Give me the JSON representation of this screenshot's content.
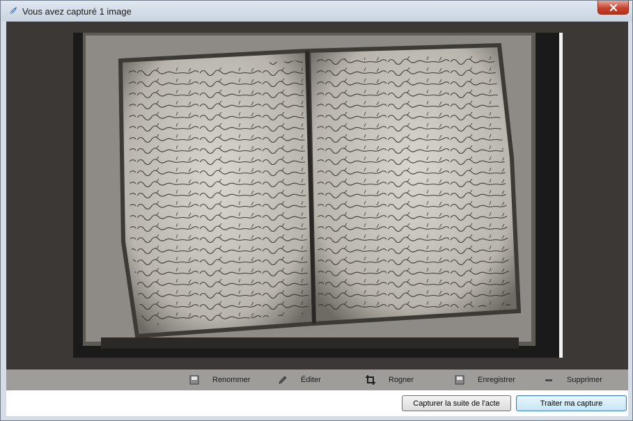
{
  "window": {
    "title": "Vous avez capturé 1 image"
  },
  "actions": [
    {
      "label": "Renommer"
    },
    {
      "label": "Éditer"
    },
    {
      "label": "Rogner"
    },
    {
      "label": "Enregistrer"
    },
    {
      "label": "Supprimer"
    }
  ],
  "footer": {
    "capture_more_label": "Capturer la suite de l'acte",
    "process_label": "Traiter ma capture"
  }
}
